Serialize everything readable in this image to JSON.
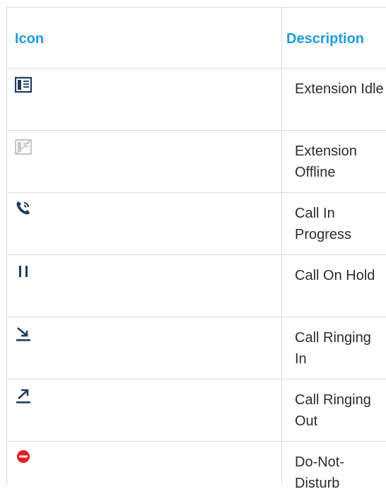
{
  "table": {
    "headers": {
      "icon": "Icon",
      "description": "Description"
    },
    "rows": [
      {
        "icon": "extension-idle-icon",
        "description": "Extension Idle"
      },
      {
        "icon": "extension-offline-icon",
        "description": "Extension Offline"
      },
      {
        "icon": "call-in-progress-icon",
        "description": "Call In Progress"
      },
      {
        "icon": "call-on-hold-icon",
        "description": "Call On Hold"
      },
      {
        "icon": "call-ringing-in-icon",
        "description": "Call Ringing In"
      },
      {
        "icon": "call-ringing-out-icon",
        "description": "Call Ringing Out"
      },
      {
        "icon": "do-not-disturb-icon",
        "description": "Do-Not-Disturb"
      }
    ]
  },
  "colors": {
    "header_text": "#1e9bd7",
    "icon_dark": "#1f3b5e",
    "icon_offline": "#c8c8c8",
    "dnd_red": "#e02020"
  }
}
